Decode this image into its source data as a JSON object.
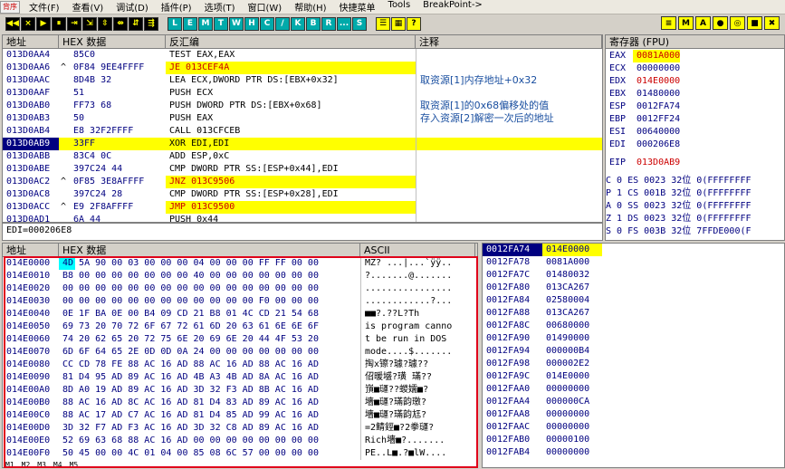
{
  "menubar": {
    "logo": "背序",
    "items": [
      "文件(F)",
      "查看(V)",
      "调试(D)",
      "插件(P)",
      "选项(T)",
      "窗口(W)",
      "帮助(H)",
      "快捷菜单",
      "Tools",
      "BreakPoint->"
    ]
  },
  "toolbar": {
    "buttons": [
      "◀◀",
      "×",
      "▶",
      "⏸",
      "⇥",
      "⇲",
      "⇳",
      "⇴",
      "⇵",
      "⇶"
    ],
    "letters": [
      "L",
      "E",
      "M",
      "T",
      "W",
      "H",
      "C",
      "/",
      "K",
      "B",
      "R",
      "...",
      "S"
    ],
    "extra": [
      "☰",
      "▦",
      "?"
    ],
    "right": [
      "≡",
      "M",
      "A",
      "●",
      "◎",
      "■",
      "✖"
    ]
  },
  "disasm": {
    "headers": [
      "地址",
      "HEX 数据",
      "反汇编",
      "注释"
    ],
    "rows": [
      {
        "addr": "013D0AA4",
        "mark": "",
        "hex": "85C0",
        "asm": "TEST EAX,EAX",
        "comment": ""
      },
      {
        "addr": "013D0AA6",
        "mark": "^",
        "hex": "0F84 9EE4FFFF",
        "asm": "JE 013CEF4A",
        "comment": ""
      },
      {
        "addr": "013D0AAC",
        "mark": "",
        "hex": "8D4B 32",
        "asm": "LEA ECX,DWORD PTR DS:[EBX+0x32]",
        "comment": "取资源[1]内存地址+0x32"
      },
      {
        "addr": "013D0AAF",
        "mark": "",
        "hex": "51",
        "asm": "PUSH ECX",
        "comment": ""
      },
      {
        "addr": "013D0AB0",
        "mark": "",
        "hex": "FF73 68",
        "asm": "PUSH DWORD PTR DS:[EBX+0x68]",
        "comment": "取资源[1]的0x68偏移处的值"
      },
      {
        "addr": "013D0AB3",
        "mark": "",
        "hex": "50",
        "asm": "PUSH EAX",
        "comment": "存入资源[2]解密一次后的地址"
      },
      {
        "addr": "013D0AB4",
        "mark": "",
        "hex": "E8 32F2FFFF",
        "asm": "CALL 013CFCEB",
        "comment": ""
      },
      {
        "addr": "013D0AB9",
        "mark": "",
        "hex": "33FF",
        "asm": "XOR EDI,EDI",
        "comment": ""
      },
      {
        "addr": "013D0ABB",
        "mark": "",
        "hex": "83C4 0C",
        "asm": "ADD ESP,0xC",
        "comment": ""
      },
      {
        "addr": "013D0ABE",
        "mark": "",
        "hex": "397C24 44",
        "asm": "CMP DWORD PTR SS:[ESP+0x44],EDI",
        "comment": ""
      },
      {
        "addr": "013D0AC2",
        "mark": "^",
        "hex": "0F85 3E8AFFFF",
        "asm": "JNZ 013C9506",
        "comment": ""
      },
      {
        "addr": "013D0AC8",
        "mark": "",
        "hex": "397C24 28",
        "asm": "CMP DWORD PTR SS:[ESP+0x28],EDI",
        "comment": ""
      },
      {
        "addr": "013D0ACC",
        "mark": "^",
        "hex": "E9 2F8AFFFF",
        "asm": "JMP 013C9500",
        "comment": ""
      },
      {
        "addr": "013D0AD1",
        "mark": "",
        "hex": "6A 44",
        "asm": "PUSH 0x44",
        "comment": ""
      }
    ],
    "status": "EDI=000206E8"
  },
  "registers": {
    "title": "寄存器 (FPU)",
    "regs": [
      {
        "name": "EAX",
        "val": "0081A000",
        "hl": true
      },
      {
        "name": "ECX",
        "val": "00000000",
        "hl": false
      },
      {
        "name": "EDX",
        "val": "014E0000",
        "hl": false
      },
      {
        "name": "EBX",
        "val": "01480000",
        "hl": false
      },
      {
        "name": "ESP",
        "val": "0012FA74",
        "hl": false
      },
      {
        "name": "EBP",
        "val": "0012FF24",
        "hl": false
      },
      {
        "name": "ESI",
        "val": "00640000",
        "hl": false
      },
      {
        "name": "EDI",
        "val": "000206E8",
        "hl": false
      }
    ],
    "eip": {
      "name": "EIP",
      "val": "013D0AB9"
    },
    "flags": [
      "C 0  ES 0023 32位 0(FFFFFFFF",
      "P 1  CS 001B 32位 0(FFFFFFFF",
      "A 0  SS 0023 32位 0(FFFFFFFF",
      "Z 1  DS 0023 32位 0(FFFFFFFF",
      "S 0  FS 003B 32位 7FFDE000(F"
    ]
  },
  "dump": {
    "headers": [
      "地址",
      "HEX 数据",
      "ASCII"
    ],
    "rows": [
      {
        "addr": "014E0000",
        "hex": "4D 5A 90 00 03 00 00 00 04 00 00 00 FF FF 00 00",
        "ascii": "MZ? ...|...`ÿÿ.."
      },
      {
        "addr": "014E0010",
        "hex": "B8 00 00 00 00 00 00 00 40 00 00 00 00 00 00 00",
        "ascii": "?.......@......."
      },
      {
        "addr": "014E0020",
        "hex": "00 00 00 00 00 00 00 00 00 00 00 00 00 00 00 00",
        "ascii": "................"
      },
      {
        "addr": "014E0030",
        "hex": "00 00 00 00 00 00 00 00 00 00 00 00 F0 00 00 00",
        "ascii": "............?..."
      },
      {
        "addr": "014E0040",
        "hex": "0E 1F BA 0E 00 B4 09 CD 21 B8 01 4C CD 21 54 68",
        "ascii": "■■?.??L?Th"
      },
      {
        "addr": "014E0050",
        "hex": "69 73 20 70 72 6F 67 72 61 6D 20 63 61 6E 6E 6F",
        "ascii": "is program canno"
      },
      {
        "addr": "014E0060",
        "hex": "74 20 62 65 20 72 75 6E 20 69 6E 20 44 4F 53 20",
        "ascii": "t be run in DOS "
      },
      {
        "addr": "014E0070",
        "hex": "6D 6F 64 65 2E 0D 0D 0A 24 00 00 00 00 00 00 00",
        "ascii": "mode....$......."
      },
      {
        "addr": "014E0080",
        "hex": "CC CD 78 FE 88 AC 16 AD 88 AC 16 AD 88 AC 16 AD",
        "ascii": "掏x镲?璩?璩??"
      },
      {
        "addr": "014E0090",
        "hex": "81 D4 95 AD 89 AC 16 AD 4B A3 4B AD 8A AC 16 AD",
        "ascii": "佋暖墭?璜  璊??"
      },
      {
        "addr": "014E00A0",
        "hex": "8D A0 19 AD 89 AC 16 AD 3D 32 F3 AD 8B AC 16 AD",
        "ascii": "嵿■璭??蝬嬬■?"
      },
      {
        "addr": "014E00B0",
        "hex": "88 AC 16 AD 8C AC 16 AD 81 D4 83 AD 89 AC 16 AD",
        "ascii": "墻■璭?璊韵璬?"
      },
      {
        "addr": "014E00C0",
        "hex": "88 AC 17 AD C7 AC 16 AD 81 D4 85 AD 99 AC 16 AD",
        "ascii": "墻■璭?璊韵尪?"
      },
      {
        "addr": "014E00D0",
        "hex": "3D 32 F7 AD F3 AC 16 AD 3D 32 C8 AD 89 AC 16 AD",
        "ascii": "=2鲭鋞■?2拳璭?"
      },
      {
        "addr": "014E00E0",
        "hex": "52 69 63 68 88 AC 16 AD 00 00 00 00 00 00 00 00",
        "ascii": "Rich墻■?......."
      },
      {
        "addr": "014E00F0",
        "hex": "50 45 00 00 4C 01 04 00 85 08 6C 57 00 00 00 00",
        "ascii": "PE..L■.?■lW...."
      }
    ],
    "tabs": [
      "M1",
      "M2",
      "M3",
      "M4",
      "M5"
    ]
  },
  "stack": {
    "rows": [
      {
        "addr": "0012FA74",
        "val": "014E0000",
        "sel": true
      },
      {
        "addr": "0012FA78",
        "val": "0081A000",
        "sel": false
      },
      {
        "addr": "0012FA7C",
        "val": "01480032",
        "sel": false
      },
      {
        "addr": "0012FA80",
        "val": "013CA267",
        "sel": false
      },
      {
        "addr": "0012FA84",
        "val": "02580004",
        "sel": false
      },
      {
        "addr": "0012FA88",
        "val": "013CA267",
        "sel": false
      },
      {
        "addr": "0012FA8C",
        "val": "00680000",
        "sel": false
      },
      {
        "addr": "0012FA90",
        "val": "01490000",
        "sel": false
      },
      {
        "addr": "0012FA94",
        "val": "000000B4",
        "sel": false
      },
      {
        "addr": "0012FA98",
        "val": "000002E2",
        "sel": false
      },
      {
        "addr": "0012FA9C",
        "val": "014E0000",
        "sel": false
      },
      {
        "addr": "0012FAA0",
        "val": "00000000",
        "sel": false
      },
      {
        "addr": "0012FAA4",
        "val": "000000CA",
        "sel": false
      },
      {
        "addr": "0012FAA8",
        "val": "00000000",
        "sel": false
      },
      {
        "addr": "0012FAAC",
        "val": "00000000",
        "sel": false
      },
      {
        "addr": "0012FAB0",
        "val": "00000100",
        "sel": false
      },
      {
        "addr": "0012FAB4",
        "val": "00000000",
        "sel": false
      }
    ]
  }
}
